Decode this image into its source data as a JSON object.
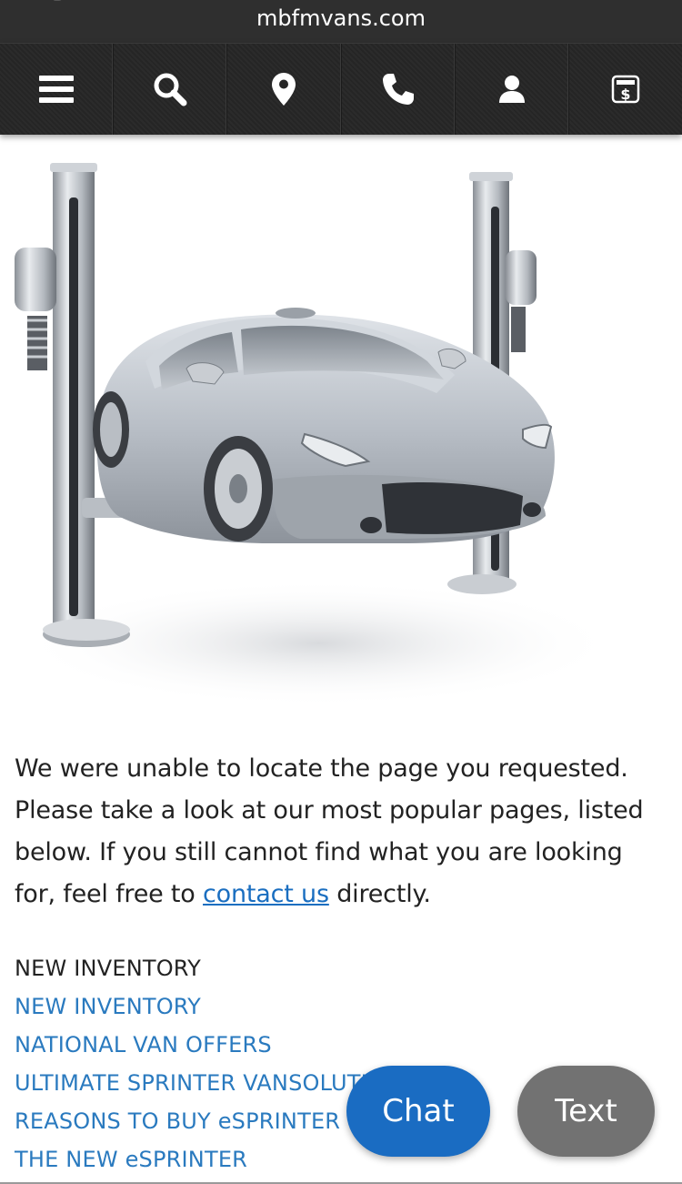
{
  "browser": {
    "url": "mbfmvans.com"
  },
  "nav": {
    "items": [
      {
        "icon": "menu-icon"
      },
      {
        "icon": "search-icon"
      },
      {
        "icon": "location-pin-icon"
      },
      {
        "icon": "phone-icon"
      },
      {
        "icon": "user-icon"
      },
      {
        "icon": "dollar-calculator-icon"
      }
    ]
  },
  "hero": {
    "image": "car-on-lift-image"
  },
  "message": {
    "text_before": "We were unable to locate the page you requested. Please take a look at our most popular pages, listed below. If you still cannot find what you are looking for, feel free to ",
    "link": "contact us",
    "text_after": " directly."
  },
  "popular": {
    "heading": "NEW INVENTORY",
    "links": [
      "NEW INVENTORY",
      "NATIONAL VAN OFFERS",
      "ULTIMATE SPRINTER VANSOLUTIO",
      "REASONS TO BUY eSPRINTER",
      "THE NEW eSPRINTER"
    ]
  },
  "actions": {
    "chat_label": "Chat",
    "text_label": "Text"
  },
  "colors": {
    "nav_bg": "#262626",
    "link": "#2a7abf",
    "chat_bg": "#1a6cc2",
    "text_bg": "#727272"
  }
}
